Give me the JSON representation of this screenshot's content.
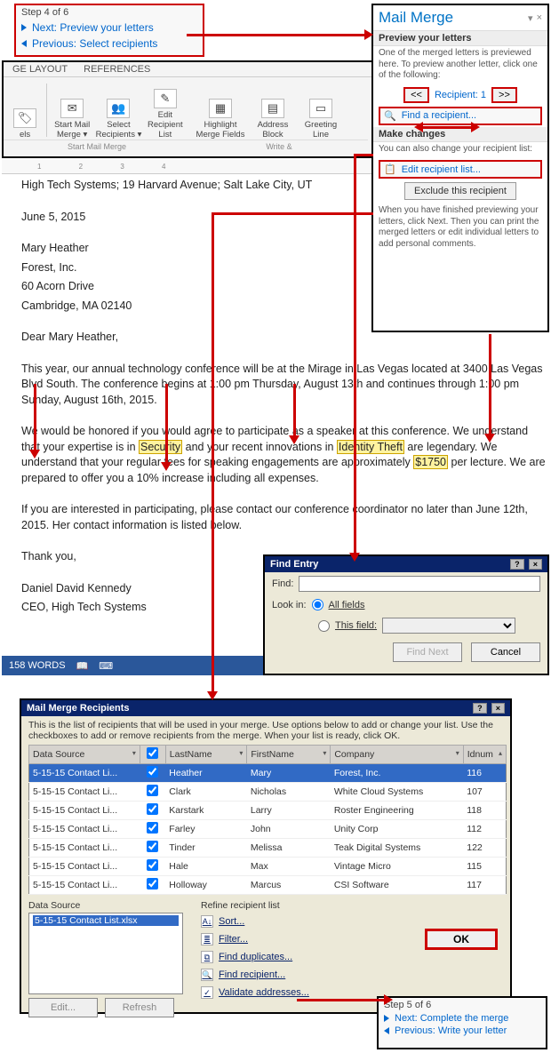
{
  "step4": {
    "label": "Step 4 of 6",
    "next": "Next: Preview your letters",
    "prev": "Previous: Select recipients"
  },
  "mailmerge_pane": {
    "title": "Mail Merge",
    "dropdown_glyph": "▾",
    "close_glyph": "×",
    "preview_head": "Preview your letters",
    "preview_body": "One of the merged letters is previewed here. To preview another letter, click one of the following:",
    "prev_btn": "<<",
    "recipient_label": "Recipient: 1",
    "next_btn": ">>",
    "find_recipient": "Find a recipient...",
    "changes_head": "Make changes",
    "changes_body": "You can also change your recipient list:",
    "edit_recipient_list": "Edit recipient list...",
    "exclude": "Exclude this recipient",
    "finish_body": "When you have finished previewing your letters, click Next. Then you can print the merged letters or edit individual letters to add personal comments."
  },
  "ribbon": {
    "tabs": {
      "layout": "GE LAYOUT",
      "references": "REFERENCES"
    },
    "btn_labels_left": "els",
    "start_mail_merge": "Start Mail Merge ▾",
    "select_recipients": "Select Recipients ▾",
    "edit_recipient_list": "Edit Recipient List",
    "group1": "Start Mail Merge",
    "highlight": "Highlight Merge Fields",
    "address_block": "Address Block",
    "greeting_line": "Greeting Line",
    "group2": "Write &"
  },
  "ruler_marks": "1 2 3 4",
  "document": {
    "header_line": "High Tech Systems; 19 Harvard Avenue; Salt Lake City, UT",
    "date": "June 5, 2015",
    "addr1": "Mary Heather",
    "addr2": "Forest, Inc.",
    "addr3": "60 Acorn Drive",
    "addr4": "Cambridge, MA 02140",
    "greeting": "Dear Mary Heather,",
    "p1": "This year, our annual technology conference will be at the Mirage in Las Vegas located at 3400 Las Vegas Blvd South. The conference begins at 1:00 pm Thursday, August 13th and continues through 1:00 pm Sunday, August 16th, 2015.",
    "p2a": "We would be honored if you would agree to participate as a speaker at this conference. We understand that your expertise is in ",
    "mf_security": "Security",
    "p2b": " and your recent innovations in ",
    "mf_identity_theft": "Identity Theft",
    "p2c": " are legendary. We understand that your regular fees for speaking engagements are approximately ",
    "mf_fee": "$1750",
    "p2d": " per lecture. We are prepared to offer you a 10% increase including all expenses.",
    "p3": "If you are interested in participating, please contact our conference coordinator no later than June 12th, 2015. Her contact information is listed below.",
    "thanks": "Thank you,",
    "sig1": "Daniel David Kennedy",
    "sig2": "CEO, High Tech Systems"
  },
  "statusbar": {
    "words": "158 WORDS",
    "icon1": "📖",
    "icon2": "⌨"
  },
  "find_dlg": {
    "title": "Find Entry",
    "help_glyph": "?",
    "close_glyph": "×",
    "find_lbl": "Find:",
    "lookin_lbl": "Look in:",
    "all_fields": "All fields",
    "this_field": "This field:",
    "find_next": "Find Next",
    "cancel": "Cancel"
  },
  "recip_dlg": {
    "title": "Mail Merge Recipients",
    "help_glyph": "?",
    "close_glyph": "×",
    "intro": "This is the list of recipients that will be used in your merge. Use options below to add or change your list. Use the checkboxes to add or remove recipients from the merge.  When your list is ready, click OK.",
    "cols": {
      "ds": "Data Source",
      "cb": "",
      "ln": "LastName",
      "fn": "FirstName",
      "co": "Company",
      "id": "Idnum"
    },
    "rows": [
      {
        "ds": "5-15-15 Contact Li...",
        "ln": "Heather",
        "fn": "Mary",
        "co": "Forest, Inc.",
        "id": "116"
      },
      {
        "ds": "5-15-15 Contact Li...",
        "ln": "Clark",
        "fn": "Nicholas",
        "co": "White Cloud Systems",
        "id": "107"
      },
      {
        "ds": "5-15-15 Contact Li...",
        "ln": "Karstark",
        "fn": "Larry",
        "co": "Roster Engineering",
        "id": "118"
      },
      {
        "ds": "5-15-15 Contact Li...",
        "ln": "Farley",
        "fn": "John",
        "co": "Unity Corp",
        "id": "112"
      },
      {
        "ds": "5-15-15 Contact Li...",
        "ln": "Tinder",
        "fn": "Melissa",
        "co": "Teak Digital Systems",
        "id": "122"
      },
      {
        "ds": "5-15-15 Contact Li...",
        "ln": "Hale",
        "fn": "Max",
        "co": "Vintage Micro",
        "id": "115"
      },
      {
        "ds": "5-15-15 Contact Li...",
        "ln": "Holloway",
        "fn": "Marcus",
        "co": "CSI Software",
        "id": "117"
      }
    ],
    "ds_label": "Data Source",
    "src_file": "5-15-15 Contact List.xlsx",
    "edit_btn": "Edit...",
    "refresh_btn": "Refresh",
    "refine_label": "Refine recipient list",
    "links": {
      "sort": "Sort...",
      "filter": "Filter...",
      "dups": "Find duplicates...",
      "find": "Find recipient...",
      "validate": "Validate addresses..."
    },
    "ok": "OK"
  },
  "step5": {
    "label": "Step 5 of 6",
    "next": "Next: Complete the merge",
    "prev": "Previous: Write your letter"
  }
}
